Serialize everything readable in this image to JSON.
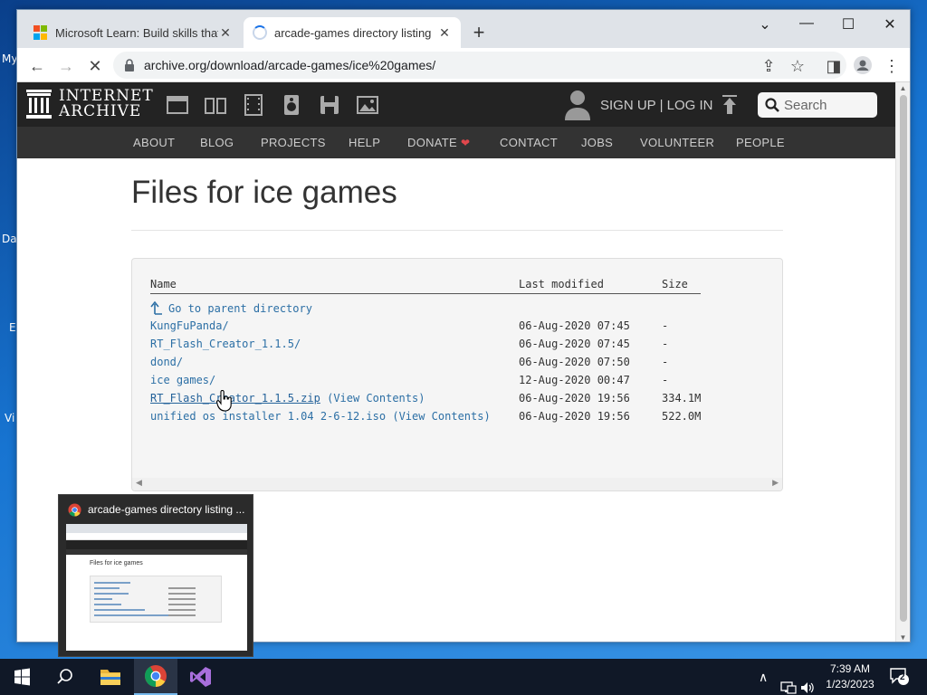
{
  "desktop": {
    "icon_fragments": [
      "My",
      "Da",
      "E",
      "Vi"
    ]
  },
  "browser": {
    "tabs": [
      {
        "title": "Microsoft Learn: Build skills that o",
        "state": "inactive"
      },
      {
        "title": "arcade-games directory listing",
        "state": "active-loading"
      }
    ],
    "new_tab_icon": "plus-icon",
    "url": "archive.org/download/arcade-games/ice%20games/"
  },
  "ia": {
    "logo_line1": "INTERNET",
    "logo_line2": "ARCHIVE",
    "media_icons": [
      "web-icon",
      "texts-icon",
      "video-icon",
      "audio-icon",
      "software-icon",
      "images-icon"
    ],
    "signup": "SIGN UP | LOG IN",
    "search_placeholder": "Search",
    "nav": [
      "ABOUT",
      "BLOG",
      "PROJECTS",
      "HELP",
      "DONATE",
      "CONTACT",
      "JOBS",
      "VOLUNTEER",
      "PEOPLE"
    ],
    "donate_heart": "❤"
  },
  "page": {
    "title": "Files for ice games",
    "listing": {
      "headers": {
        "name": "Name",
        "modified": "Last modified",
        "size": "Size"
      },
      "parent": "Go to parent directory",
      "rows": [
        {
          "name": "KungFuPanda/",
          "modified": "06-Aug-2020 07:45",
          "size": "-"
        },
        {
          "name": "RT_Flash_Creator_1.1.5/",
          "modified": "06-Aug-2020 07:45",
          "size": "-"
        },
        {
          "name": "dond/",
          "modified": "06-Aug-2020 07:50",
          "size": "-"
        },
        {
          "name": "ice games/",
          "modified": "12-Aug-2020 00:47",
          "size": "-"
        },
        {
          "name": "RT_Flash_Creator_1.1.5.zip",
          "view": "View Contents",
          "modified": "06-Aug-2020 19:56",
          "size": "334.1M"
        },
        {
          "name": "unified os installer 1.04 2-6-12.iso",
          "view": "View Contents",
          "modified": "06-Aug-2020 19:56",
          "size": "522.0M"
        }
      ],
      "paren_open": "(",
      "paren_close": ")"
    }
  },
  "preview": {
    "title": "arcade-games directory listing ...",
    "thumb_heading": "Files for ice games"
  },
  "taskbar": {
    "time": "7:39 AM",
    "date": "1/23/2023",
    "notification_count": "2"
  }
}
